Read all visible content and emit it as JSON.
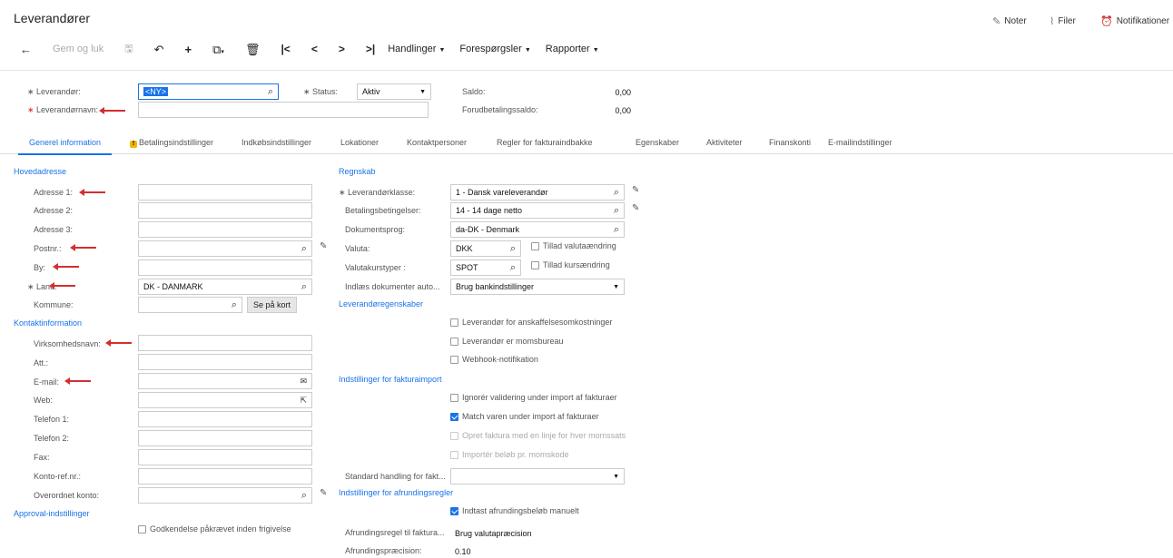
{
  "header": {
    "title": "Leverandører",
    "links": [
      {
        "label": "Noter",
        "icon": "note-icon"
      },
      {
        "label": "Filer",
        "icon": "paperclip-icon"
      },
      {
        "label": "Notifikationer",
        "icon": "alarm-icon"
      }
    ]
  },
  "toolbar": {
    "back": "←",
    "save_close": "Gem og luk",
    "save_icon": "🖫",
    "undo": "↶",
    "add": "+",
    "copy": "⧉",
    "delete": "🗑",
    "first": "|<",
    "prev": "<",
    "next": ">",
    "last": ">|",
    "menus": [
      "Handlinger",
      "Forespørgsler",
      "Rapporter"
    ]
  },
  "form": {
    "vendor_label": "Leverandør:",
    "vendor_value": "<NY>",
    "status_label": "Status:",
    "status_value": "Aktiv",
    "vendor_name_label": "Leverandørnavn:",
    "vendor_name_value": "",
    "balance_label": "Saldo:",
    "balance_value": "0,00",
    "prepay_label": "Forudbetalingssaldo:",
    "prepay_value": "0,00"
  },
  "tabs": [
    "Generel information",
    "Betalingsindstillinger",
    "Indkøbsindstillinger",
    "Lokationer",
    "Kontaktpersoner",
    "Regler for fakturaindbakke",
    "Egenskaber",
    "Aktiviteter",
    "Finanskonti",
    "E-mailindstillinger"
  ],
  "left": {
    "main_address_title": "Hovedadresse",
    "address1": "Adresse 1:",
    "address2": "Adresse 2:",
    "address3": "Adresse 3:",
    "postal": "Postnr.:",
    "city": "By:",
    "country": "Land:",
    "country_value": "DK - DANMARK",
    "municipality": "Kommune:",
    "see_map": "Se på kort",
    "contact_title": "Kontaktinformation",
    "company": "Virksomhedsnavn:",
    "attn": "Att.:",
    "email": "E-mail:",
    "web": "Web:",
    "phone1": "Telefon 1:",
    "phone2": "Telefon 2:",
    "fax": "Fax:",
    "account_ref": "Konto-ref.nr.:",
    "parent_account": "Overordnet konto:",
    "approval_title": "Approval-indstillinger",
    "approval_required": "Godkendelse påkrævet inden frigivelse"
  },
  "right": {
    "accounting_title": "Regnskab",
    "vendor_class": "Leverandørklasse:",
    "vendor_class_value": "1 - Dansk vareleverandør",
    "payment_terms": "Betalingsbetingelser:",
    "payment_terms_value": "14 - 14 dage netto",
    "doc_lang": "Dokumentsprog:",
    "doc_lang_value": "da-DK - Denmark",
    "currency": "Valuta:",
    "currency_value": "DKK",
    "allow_currency": "Tillad valutaændring",
    "rate_type": "Valutakurstyper :",
    "rate_type_value": "SPOT",
    "allow_rate": "Tillad kursændring",
    "load_docs": "Indlæs dokumenter auto...",
    "load_docs_value": "Brug bankindstillinger",
    "vendor_props_title": "Leverandøregenskaber",
    "prop1": "Leverandør for anskaffelsesomkostninger",
    "prop2": "Leverandør er momsbureau",
    "prop3": "Webhook-notifikation",
    "invoice_import_title": "Indstillinger for fakturaimport",
    "imp1": "Ignorér validering under import af fakturaer",
    "imp2": "Match varen under import af fakturaer",
    "imp3": "Opret faktura med en linje for hver momssats",
    "imp4": "Importér beløb pr. momskode",
    "std_handling": "Standard handling for fakt...",
    "std_handling_value": "",
    "rounding_title": "Indstillinger for afrundingsregler",
    "manual_rounding": "Indtast afrundingsbeløb manuelt",
    "rounding_rule": "Afrundingsregel til faktura...",
    "rounding_rule_value": "Brug valutapræcision",
    "rounding_precision": "Afrundingspræcision:",
    "rounding_precision_value": "0.10"
  }
}
